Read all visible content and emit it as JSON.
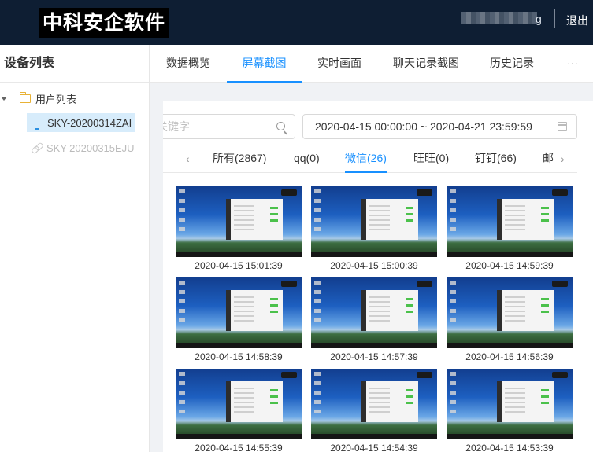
{
  "header": {
    "brand": "中科安企软件",
    "user_suffix": "g",
    "logout_label": "退出"
  },
  "sidebar": {
    "title": "设备列表",
    "root_label": "用户列表",
    "devices": [
      {
        "label": "SKY-20200314ZAI",
        "status": "online"
      },
      {
        "label": "SKY-20200315EJU",
        "status": "offline"
      }
    ]
  },
  "tabs": [
    {
      "label": "数据概览"
    },
    {
      "label": "屏幕截图",
      "active": true
    },
    {
      "label": "实时画面"
    },
    {
      "label": "聊天记录截图"
    },
    {
      "label": "历史记录"
    },
    {
      "label": "···"
    }
  ],
  "search": {
    "placeholder": "关键字"
  },
  "date_range": "2020-04-15 00:00:00 ~ 2020-04-21 23:59:59",
  "subtabs": [
    {
      "label": "所有(2867)"
    },
    {
      "label": "qq(0)"
    },
    {
      "label": "微信(26)",
      "active": true
    },
    {
      "label": "旺旺(0)"
    },
    {
      "label": "钉钉(66)"
    },
    {
      "label": "邮"
    }
  ],
  "screenshots": [
    {
      "time": "2020-04-15 15:01:39"
    },
    {
      "time": "2020-04-15 15:00:39"
    },
    {
      "time": "2020-04-15 14:59:39"
    },
    {
      "time": "2020-04-15 14:58:39"
    },
    {
      "time": "2020-04-15 14:57:39"
    },
    {
      "time": "2020-04-15 14:56:39"
    },
    {
      "time": "2020-04-15 14:55:39"
    },
    {
      "time": "2020-04-15 14:54:39"
    },
    {
      "time": "2020-04-15 14:53:39"
    }
  ],
  "colors": {
    "accent": "#1890ff",
    "topbar": "#0e1e33"
  }
}
